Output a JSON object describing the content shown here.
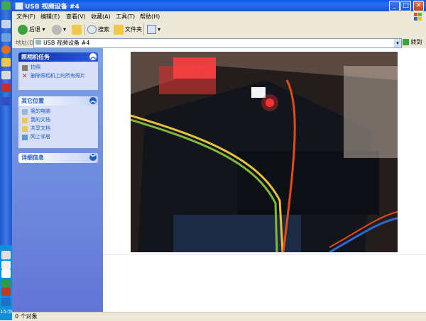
{
  "window": {
    "title": "USB 视频设备 #4"
  },
  "menu": [
    "文件(F)",
    "编辑(E)",
    "查看(V)",
    "收藏(A)",
    "工具(T)",
    "帮助(H)"
  ],
  "toolbar": {
    "back": "后退",
    "search": "搜索",
    "folders": "文件夹"
  },
  "address": {
    "label": "地址(D)",
    "value": "USB 视频设备 #4",
    "go": "转到"
  },
  "panels": {
    "camera": {
      "title": "照相机任务",
      "items": [
        "拍照",
        "删除照相机上的所有照片"
      ]
    },
    "other": {
      "title": "其它位置",
      "items": [
        "我的电脑",
        "我的文档",
        "共享文档",
        "网上邻居"
      ]
    },
    "details": {
      "title": "详细信息"
    }
  },
  "status": {
    "text": "0 个对象"
  },
  "taskbar": {
    "clock": "15:50"
  },
  "colors": {
    "titlebar": "#0a5fe8",
    "taskpane": "#7ba2e7",
    "close": "#c33f1c"
  }
}
